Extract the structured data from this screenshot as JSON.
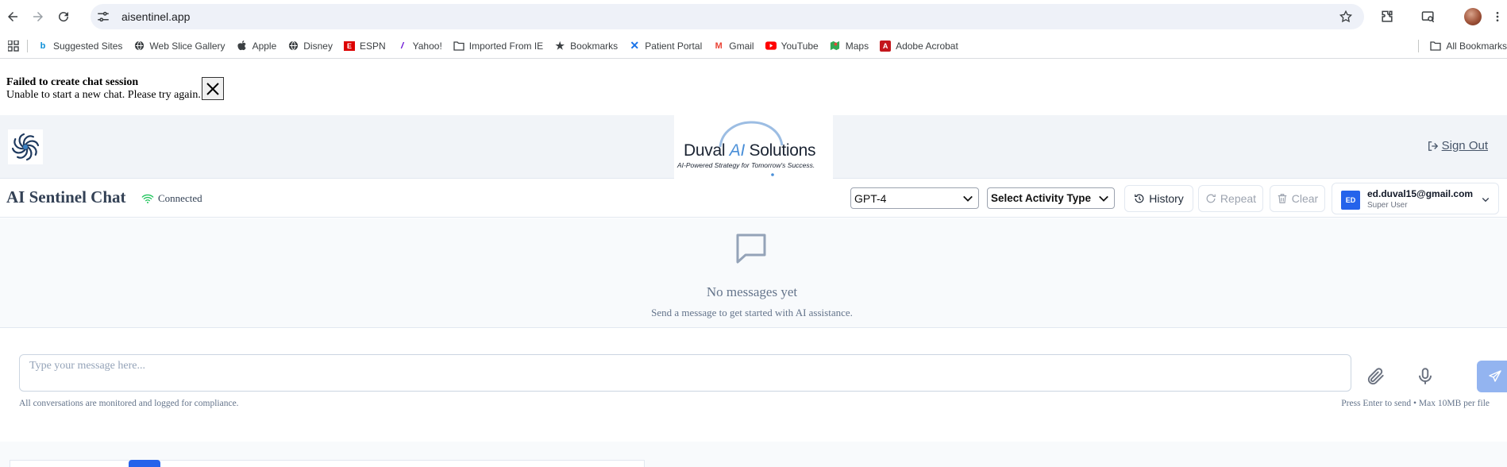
{
  "browser": {
    "url": "aisentinel.app",
    "bookmarks": [
      {
        "label": "Suggested Sites",
        "icon": "bing-icon"
      },
      {
        "label": "Web Slice Gallery",
        "icon": "globe-icon"
      },
      {
        "label": "Apple",
        "icon": "apple-icon"
      },
      {
        "label": "Disney",
        "icon": "globe-icon"
      },
      {
        "label": "ESPN",
        "icon": "espn-icon"
      },
      {
        "label": "Yahoo!",
        "icon": "yahoo-icon"
      },
      {
        "label": "Imported From IE",
        "icon": "folder-icon"
      },
      {
        "label": "Bookmarks",
        "icon": "star-icon"
      },
      {
        "label": "Patient Portal",
        "icon": "x-icon"
      },
      {
        "label": "Gmail",
        "icon": "gmail-icon"
      },
      {
        "label": "YouTube",
        "icon": "youtube-icon"
      },
      {
        "label": "Maps",
        "icon": "maps-icon"
      },
      {
        "label": "Adobe Acrobat",
        "icon": "acrobat-icon"
      }
    ],
    "all_bookmarks": "All Bookmarks"
  },
  "error": {
    "title": "Failed to create chat session",
    "message": "Unable to start a new chat. Please try again."
  },
  "header": {
    "brand_name_pre": "Duval ",
    "brand_name_ai": "AI",
    "brand_name_post": " Solutions",
    "brand_tagline": "AI-Powered Strategy for Tomorrow's Success.",
    "sign_out": "Sign Out"
  },
  "chat": {
    "title": "AI Sentinel Chat",
    "status": "Connected",
    "model": "GPT-4",
    "activity": "Select Activity Type",
    "history": "History",
    "repeat": "Repeat",
    "clear": "Clear"
  },
  "user": {
    "initials": "ED",
    "email": "ed.duval15@gmail.com",
    "role": "Super User"
  },
  "empty_state": {
    "title": "No messages yet",
    "subtitle": "Send a message to get started with AI assistance."
  },
  "composer": {
    "placeholder": "Type your message here...",
    "compliance": "All conversations are monitored and logged for compliance.",
    "hint": "Press Enter to send • Max 10MB per file"
  },
  "colors": {
    "accent": "#2563eb",
    "send": "#93b4f0",
    "connected": "#22c55e",
    "header_bg": "#f1f4f8"
  }
}
